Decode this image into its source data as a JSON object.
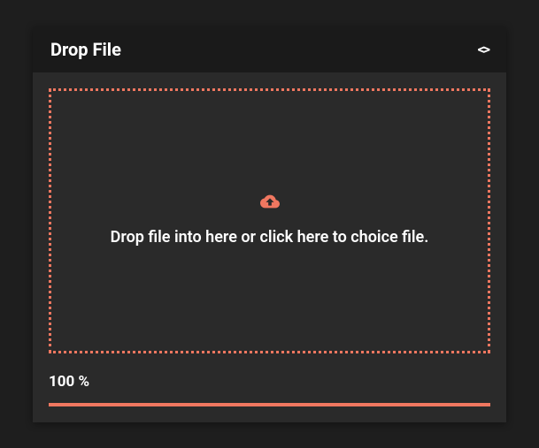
{
  "header": {
    "title": "Drop File"
  },
  "dropzone": {
    "text": "Drop file into here or click here to choice file."
  },
  "progress": {
    "label": "100 %",
    "percent": 100
  },
  "colors": {
    "accent": "#f07760",
    "bg": "#2a2a2a",
    "headerBg": "#1a1a1a"
  }
}
